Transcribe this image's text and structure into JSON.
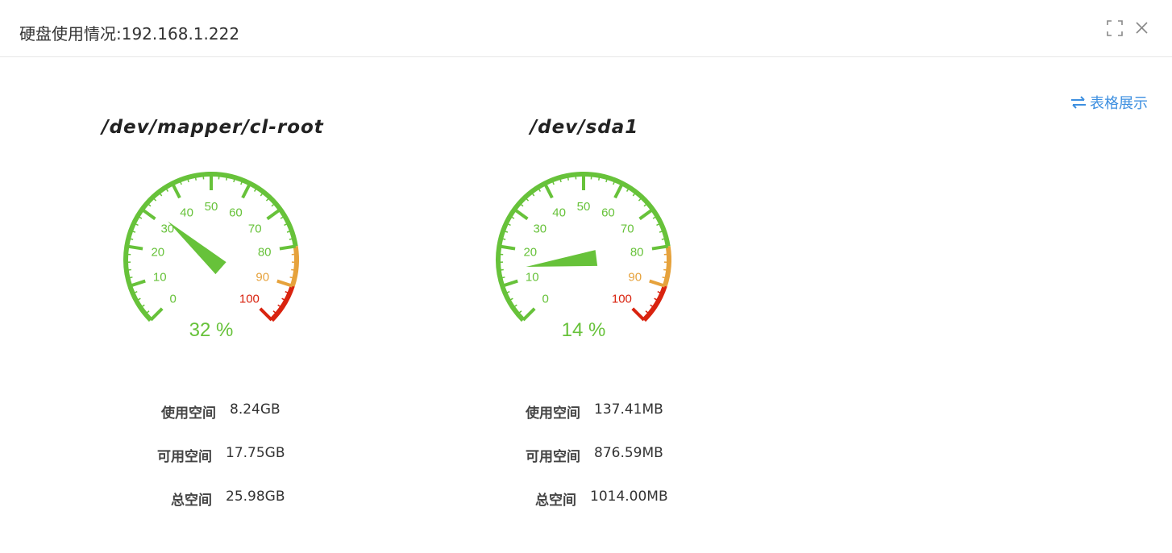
{
  "window": {
    "title": "硬盘使用情况:192.168.1.222",
    "maximize_icon": "maximize-icon",
    "close_icon": "close-icon"
  },
  "view_toggle": {
    "icon": "swap-arrows-icon",
    "label": "表格展示"
  },
  "colors": {
    "gauge_green": "#67c23a",
    "gauge_orange": "#e6a23c",
    "gauge_red": "#d9230f",
    "link_blue": "#3d8fe0"
  },
  "gauge_scale": {
    "min": 0,
    "max": 100,
    "ticks": [
      "0",
      "10",
      "20",
      "30",
      "40",
      "50",
      "60",
      "70",
      "80",
      "90",
      "100"
    ],
    "bands": [
      {
        "from": 0,
        "to": 80,
        "color": "#67c23a"
      },
      {
        "from": 80,
        "to": 90,
        "color": "#e6a23c"
      },
      {
        "from": 90,
        "to": 100,
        "color": "#d9230f"
      }
    ]
  },
  "disks": [
    {
      "name": "/dev/mapper/cl-root",
      "percent": 32,
      "percent_text": "32 %",
      "used_label": "使用空间",
      "used_value": "8.24GB",
      "available_label": "可用空间",
      "available_value": "17.75GB",
      "total_label": "总空间",
      "total_value": "25.98GB"
    },
    {
      "name": "/dev/sda1",
      "percent": 14,
      "percent_text": "14 %",
      "used_label": "使用空间",
      "used_value": "137.41MB",
      "available_label": "可用空间",
      "available_value": "876.59MB",
      "total_label": "总空间",
      "total_value": "1014.00MB"
    }
  ]
}
